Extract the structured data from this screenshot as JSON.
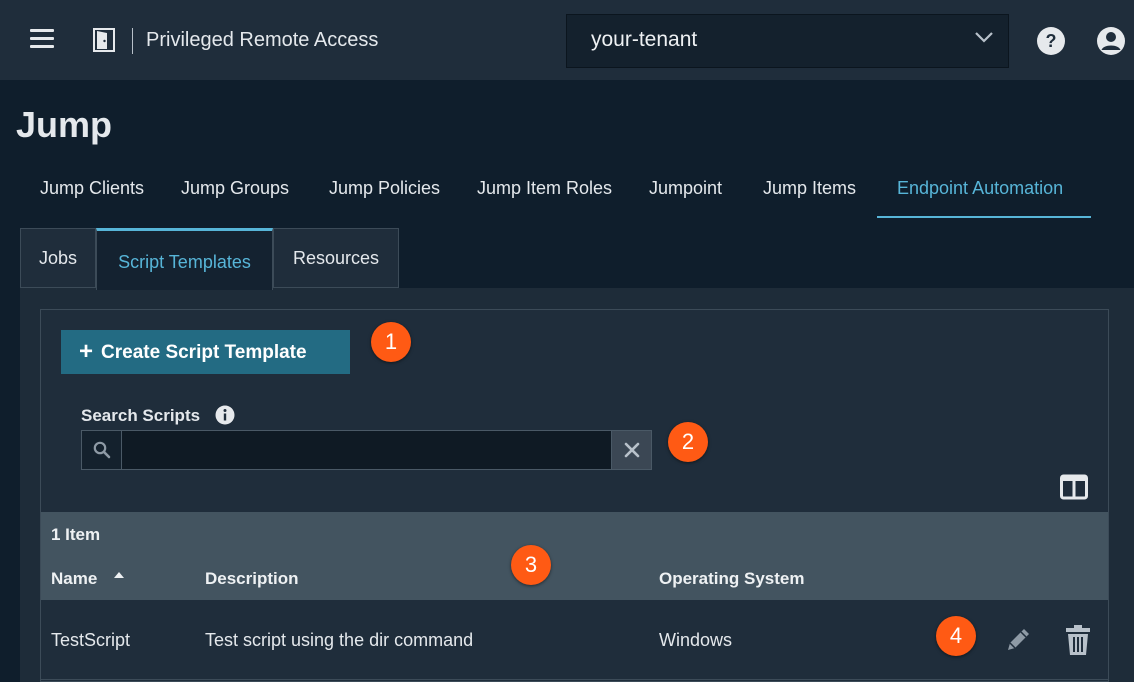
{
  "header": {
    "menu_icon": "hamburger-menu-icon",
    "app_icon": "door-icon",
    "app_title": "Privileged Remote Access",
    "tenant": "your-tenant",
    "help_icon": "question-circle-icon",
    "user_icon": "user-circle-icon"
  },
  "page": {
    "title": "Jump"
  },
  "nav": {
    "items": [
      {
        "label": "Jump Clients"
      },
      {
        "label": "Jump Groups"
      },
      {
        "label": "Jump Policies"
      },
      {
        "label": "Jump Item Roles"
      },
      {
        "label": "Jumpoint"
      },
      {
        "label": "Jump Items"
      },
      {
        "label": "Endpoint Automation",
        "active": true
      }
    ]
  },
  "subtabs": {
    "items": [
      {
        "label": "Jobs"
      },
      {
        "label": "Script Templates",
        "active": true
      },
      {
        "label": "Resources"
      }
    ]
  },
  "toolbar": {
    "create_plus": "+",
    "create_label": "Create Script Template"
  },
  "search": {
    "label": "Search Scripts",
    "value": "",
    "placeholder": ""
  },
  "table": {
    "item_count": "1 Item",
    "columns": [
      "Name",
      "Description",
      "Operating System"
    ],
    "sorted_column": "Name",
    "sort_direction": "ascending",
    "rows": [
      {
        "name": "TestScript",
        "description": "Test script using the dir command",
        "os": "Windows"
      }
    ]
  },
  "callouts": [
    "1",
    "2",
    "3",
    "4"
  ],
  "colors": {
    "accent": "#57b5d8",
    "primary_button": "#236b83",
    "callout": "#ff5a14",
    "table_header": "#435460",
    "topbar": "#1f2d3b",
    "background": "#0f1e2c"
  }
}
